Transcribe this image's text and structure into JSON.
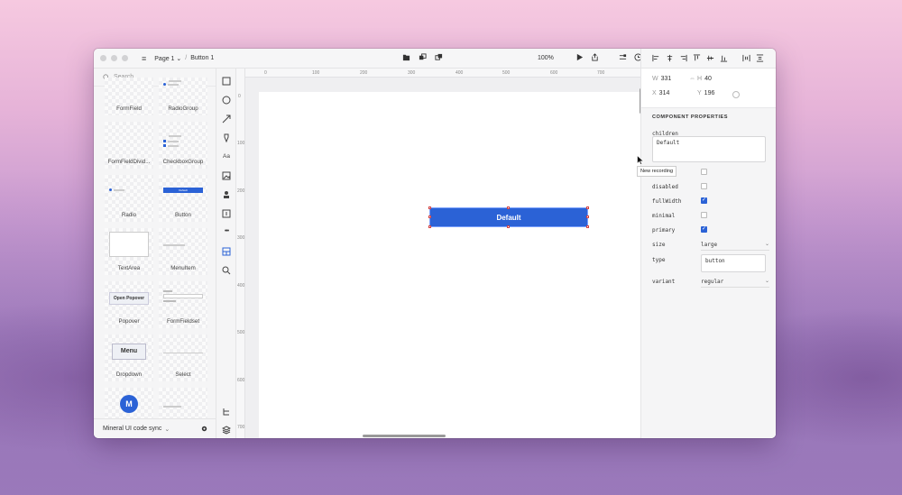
{
  "titlebar": {
    "page": "Page 1",
    "page_chevron": "⌄",
    "separator": "/",
    "selection": "Button 1",
    "zoom": "100%"
  },
  "library": {
    "search_placeholder": "Search...",
    "items": [
      {
        "label": "FormField"
      },
      {
        "label": "RadioGroup"
      },
      {
        "label": "FormFieldDivid..."
      },
      {
        "label": "CheckboxGroup"
      },
      {
        "label": "Radio"
      },
      {
        "label": "Button"
      },
      {
        "label": "TextArea"
      },
      {
        "label": "MenuItem"
      },
      {
        "label": "Popover"
      },
      {
        "label": "FormFieldset"
      },
      {
        "label": "Dropdown"
      },
      {
        "label": "Select"
      }
    ],
    "popover_thumb": "Open Popover",
    "dropdown_thumb": "Menu",
    "avatar_letter": "M",
    "button_thumb": "Default",
    "footer": "Mineral UI code sync",
    "footer_chevron": "⌄"
  },
  "ruler": {
    "h": [
      "0",
      "100",
      "200",
      "300",
      "400",
      "500",
      "600",
      "700"
    ],
    "v": [
      "0",
      "100",
      "200",
      "300",
      "400",
      "500",
      "600",
      "700"
    ]
  },
  "canvas": {
    "button_label": "Default",
    "tooltip": "New recording"
  },
  "props": {
    "w_label": "W",
    "w": "331",
    "h_label": "H",
    "h": "40",
    "x_label": "X",
    "x": "314",
    "y_label": "Y",
    "y": "196",
    "section_title": "COMPONENT PROPERTIES",
    "children_label": "children",
    "children_value": "Default",
    "disabled_label": "disabled",
    "fullwidth_label": "fullWidth",
    "minimal_label": "minimal",
    "primary_label": "primary",
    "size_label": "size",
    "size_value": "large",
    "type_label": "type",
    "type_value": "button",
    "variant_label": "variant",
    "variant_value": "regular",
    "checkmark": "✓",
    "chevron": "⌄"
  },
  "colors": {
    "accent": "#2b62d6"
  }
}
